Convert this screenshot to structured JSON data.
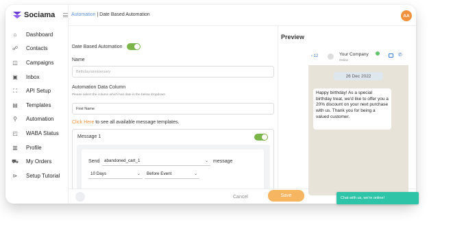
{
  "brand": {
    "name": "Sociama"
  },
  "sidebar": {
    "items": [
      {
        "label": "Dashboard",
        "icon": "home-icon"
      },
      {
        "label": "Contacts",
        "icon": "contacts-icon"
      },
      {
        "label": "Campaigns",
        "icon": "campaigns-icon"
      },
      {
        "label": "Inbox",
        "icon": "inbox-icon"
      },
      {
        "label": "API Setup",
        "icon": "api-icon"
      },
      {
        "label": "Templates",
        "icon": "templates-icon"
      },
      {
        "label": "Automation",
        "icon": "automation-icon"
      },
      {
        "label": "WABA Status",
        "icon": "waba-icon"
      },
      {
        "label": "Profile",
        "icon": "profile-icon"
      },
      {
        "label": "My Orders",
        "icon": "cart-icon"
      },
      {
        "label": "Setup Tutorial",
        "icon": "play-icon"
      }
    ]
  },
  "header": {
    "crumb_root": "Automation",
    "crumb_sep": " | ",
    "crumb_current": "Date Based Automation",
    "avatar_initials": "AA"
  },
  "form": {
    "toggle_label": "Date Based Automation",
    "toggle_on": true,
    "name_label": "Name",
    "name_placeholder": "Birthday/anniversary",
    "column_label": "Automation Data Column",
    "column_hint": "Please select the column which has date in the below dropdown",
    "column_value": "First Name",
    "click_here": "Click Here",
    "click_rest": " to see all available message templates.",
    "message_title": "Message 1",
    "send_label": "Send",
    "template_value": "abandoned_cart_1",
    "message_word": "message",
    "days_value": "10 Days",
    "event_value": "Before Event"
  },
  "footer": {
    "cancel": "Cancel",
    "save": "Save"
  },
  "preview": {
    "title": "Preview",
    "back_count": "12",
    "company": "Your Company",
    "status": "Online",
    "date": "26 Dec 2022",
    "message": "Happy birthday! As a special birthday treat, we'd like to offer you a 20% discount on your next purchase with us. Thank you for being a valued customer."
  },
  "chat_widget": {
    "text": "Chat with us, we're online!"
  },
  "colors": {
    "accent_orange": "#f0923c",
    "toggle_green": "#7bb54a",
    "chat_teal": "#2ec4a8",
    "link_blue": "#5a8fd6"
  }
}
